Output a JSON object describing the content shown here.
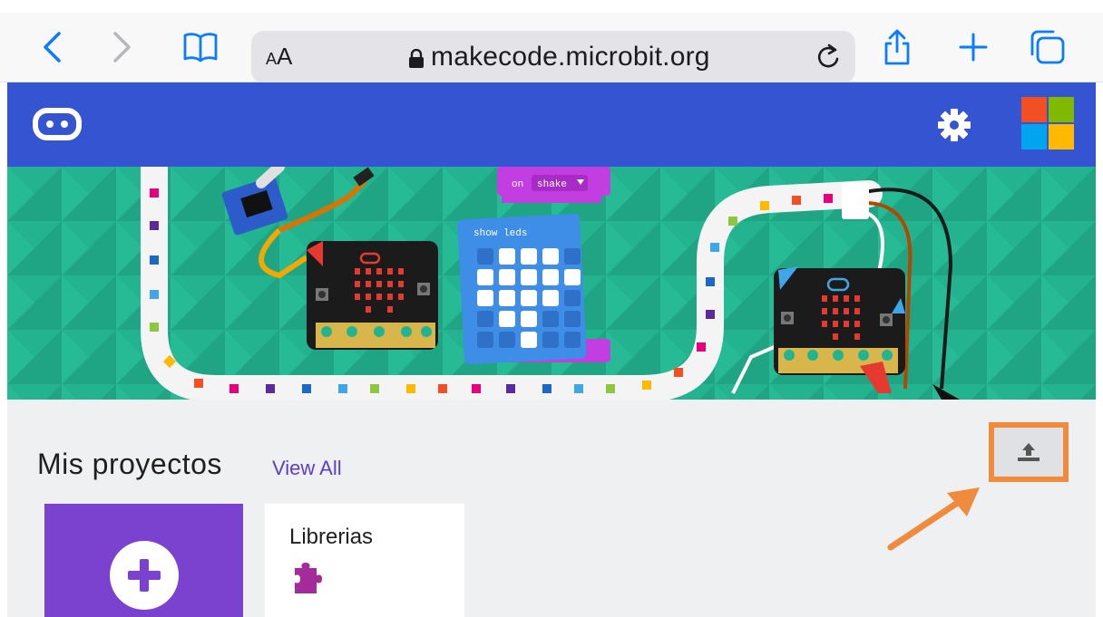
{
  "browser": {
    "text_size_label": "AA",
    "url": "makecode.microbit.org"
  },
  "projects": {
    "title": "Mis proyectos",
    "view_all": "View All",
    "cards": [
      {
        "title": "Librerias"
      }
    ]
  },
  "hero": {
    "block_event_label": "on",
    "block_event_value": "shake",
    "block_show_leds": "show leds"
  },
  "colors": {
    "header": "#3454d1",
    "hero": "#23b48f",
    "new_project": "#7b41cf",
    "highlight": "#f08a3c",
    "link": "#5b3ec8"
  }
}
